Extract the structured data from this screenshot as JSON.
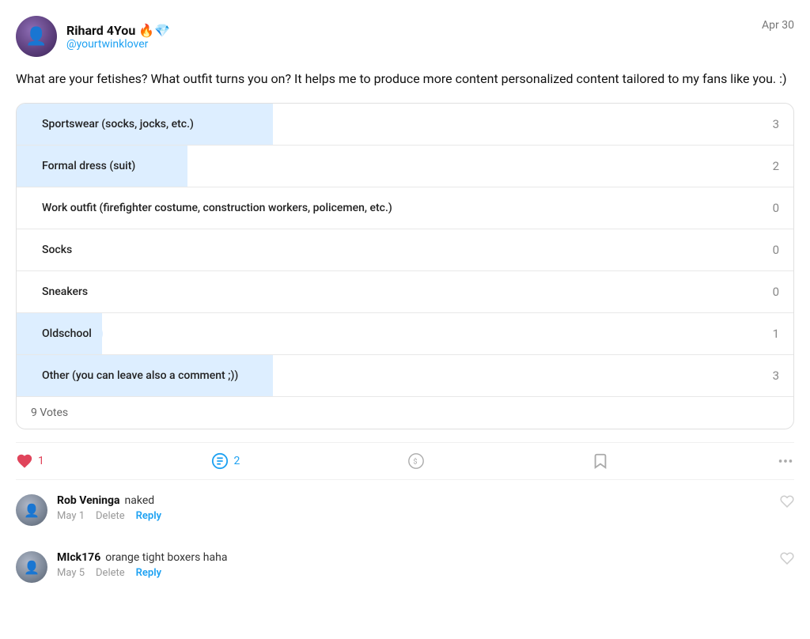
{
  "post": {
    "username": "Rihard 4You",
    "username_emojis": "🔥💎",
    "handle": "@yourtwinklover",
    "date": "Apr 30",
    "body": "What are your fetishes? What outfit turns you on? It helps me to produce more content personalized content tailored to my fans like you. :)",
    "poll": {
      "options": [
        {
          "label": "Sportswear (socks, jocks, etc.)",
          "votes": 3,
          "highlighted": true,
          "bar_pct": 33
        },
        {
          "label": "Formal dress (suit)",
          "votes": 2,
          "highlighted": true,
          "bar_pct": 22
        },
        {
          "label": "Work outfit (firefighter costume, construction workers, policemen, etc.)",
          "votes": 0,
          "highlighted": false,
          "bar_pct": 0
        },
        {
          "label": "Socks",
          "votes": 0,
          "highlighted": false,
          "bar_pct": 0
        },
        {
          "label": "Sneakers",
          "votes": 0,
          "highlighted": false,
          "bar_pct": 0
        },
        {
          "label": "Oldschool",
          "votes": 1,
          "highlighted": true,
          "bar_pct": 11
        },
        {
          "label": "Other (you can leave also a comment ;))",
          "votes": 3,
          "highlighted": true,
          "bar_pct": 33
        }
      ],
      "total_votes": "9 Votes"
    },
    "actions": {
      "likes": 1,
      "comments": 2,
      "tip_label": "",
      "bookmark_label": "",
      "more_label": ""
    }
  },
  "comments": [
    {
      "username": "Rob Veninga",
      "text": "naked",
      "date": "May 1",
      "delete_label": "Delete",
      "reply_label": "Reply"
    },
    {
      "username": "MIck176",
      "text": "orange tight boxers haha",
      "date": "May 5",
      "delete_label": "Delete",
      "reply_label": "Reply"
    }
  ]
}
